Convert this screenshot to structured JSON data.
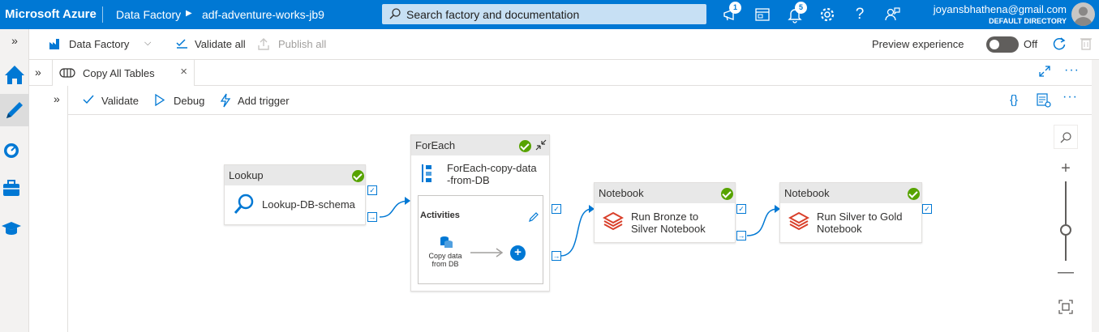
{
  "topbar": {
    "brand": "Microsoft Azure",
    "breadcrumb_service": "Data Factory",
    "breadcrumb_factory": "adf-adventure-works-jb9",
    "search_placeholder": "Search factory and documentation",
    "notifications_badge_1": "1",
    "notifications_badge_2": "5",
    "user_email": "joyansbhathena@gmail.com",
    "user_directory": "DEFAULT DIRECTORY"
  },
  "factory_bar": {
    "data_factory": "Data Factory",
    "validate_all": "Validate all",
    "publish_all": "Publish all",
    "preview_experience": "Preview experience",
    "toggle_state": "Off"
  },
  "tab": {
    "label": "Copy All Tables"
  },
  "canvas_bar": {
    "validate": "Validate",
    "debug": "Debug",
    "add_trigger": "Add trigger",
    "code_icon": "{}"
  },
  "activities": {
    "lookup": {
      "type": "Lookup",
      "name": "Lookup-DB-schema"
    },
    "foreach": {
      "type": "ForEach",
      "name_line1": "ForEach-copy-data",
      "name_line2": "-from-DB",
      "activities_label": "Activities",
      "inner_label_1": "Copy data",
      "inner_label_2": "from DB"
    },
    "notebook1": {
      "type": "Notebook",
      "name_line1": "Run Bronze to",
      "name_line2": "Silver Notebook"
    },
    "notebook2": {
      "type": "Notebook",
      "name_line1": "Run Silver to Gold",
      "name_line2": "Notebook"
    }
  },
  "colors": {
    "accent": "#0078d4",
    "success": "#57a300",
    "notebook": "#d9402b"
  }
}
